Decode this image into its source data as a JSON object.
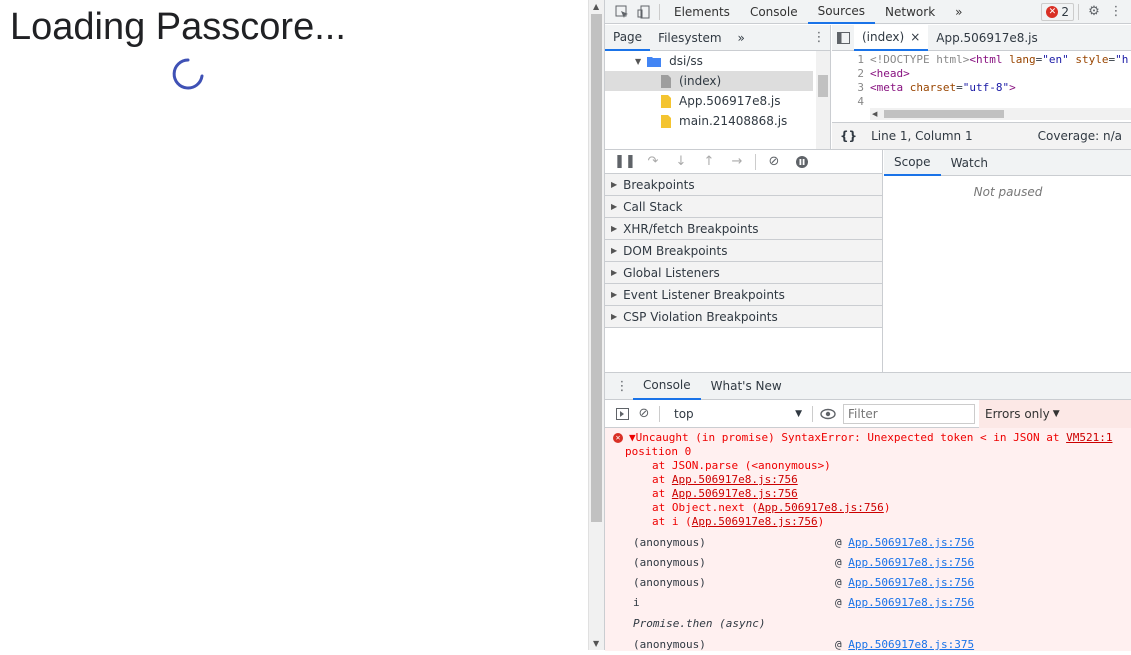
{
  "page": {
    "title": "Loading Passcore..."
  },
  "devtools": {
    "tabs": [
      "Elements",
      "Console",
      "Sources",
      "Network"
    ],
    "more_tabs": "»",
    "error_count": "2",
    "navigator": {
      "tabs": [
        "Page",
        "Filesystem"
      ],
      "more": "»",
      "tree": [
        {
          "label": "dsi/ss",
          "type": "folder"
        },
        {
          "label": "(index)",
          "type": "file",
          "selected": true
        },
        {
          "label": "App.506917e8.js",
          "type": "js"
        },
        {
          "label": "main.21408868.js",
          "type": "js"
        }
      ]
    },
    "editor": {
      "tabs": [
        "(index)",
        "App.506917e8.js"
      ],
      "close": "×",
      "lines": [
        {
          "n": "1",
          "text": "<!DOCTYPE html><html lang=\"en\" style=\"h"
        },
        {
          "n": "2",
          "text": "<head>"
        },
        {
          "n": "3",
          "text": "<meta charset=\"utf-8\">"
        },
        {
          "n": "4",
          "text": ""
        }
      ],
      "format_btn": "{}",
      "position": "Line 1, Column 1",
      "coverage": "Coverage: n/a"
    },
    "debugger": {
      "sections": [
        "Breakpoints",
        "Call Stack",
        "XHR/fetch Breakpoints",
        "DOM Breakpoints",
        "Global Listeners",
        "Event Listener Breakpoints",
        "CSP Violation Breakpoints"
      ],
      "scope_tabs": [
        "Scope",
        "Watch"
      ],
      "not_paused": "Not paused"
    },
    "console": {
      "tabs": [
        "Console",
        "What's New"
      ],
      "context": "top",
      "filter_placeholder": "Filter",
      "levels": "Errors only",
      "error": {
        "headline": "▼Uncaught (in promise) SyntaxError: Unexpected token < in JSON at",
        "link": "VM521:1",
        "position": "position 0",
        "frames": [
          {
            "pre": "at JSON.parse (<anonymous>)",
            "link": ""
          },
          {
            "pre": "at ",
            "link": "App.506917e8.js:756"
          },
          {
            "pre": "at ",
            "link": "App.506917e8.js:756"
          },
          {
            "pre": "at Object.next (",
            "link": "App.506917e8.js:756",
            "post": ")"
          },
          {
            "pre": "at i (",
            "link": "App.506917e8.js:756",
            "post": ")"
          }
        ]
      },
      "stack": [
        {
          "fn": "(anonymous)",
          "link": "App.506917e8.js:756"
        },
        {
          "fn": "(anonymous)",
          "link": "App.506917e8.js:756"
        },
        {
          "fn": "(anonymous)",
          "link": "App.506917e8.js:756"
        },
        {
          "fn": "i",
          "link": "App.506917e8.js:756"
        },
        {
          "fn": "Promise.then (async)",
          "link": "",
          "italic": true
        },
        {
          "fn": "(anonymous)",
          "link": "App.506917e8.js:375"
        }
      ]
    }
  }
}
